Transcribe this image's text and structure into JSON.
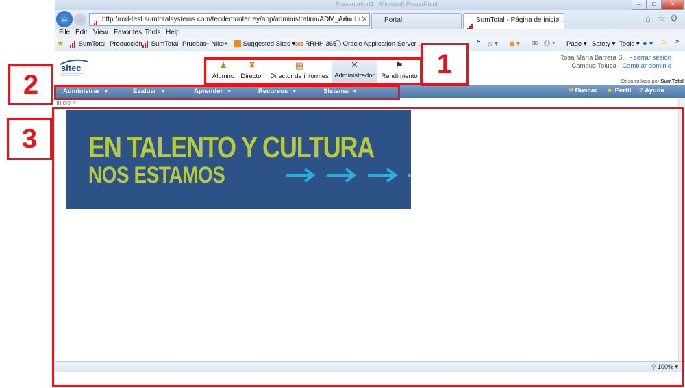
{
  "browser": {
    "address_url": "http://rod-test.sumtotalsystems.com/tecdemonterrey/app/administration/ADM_Adn",
    "address_controls": "⌕ ▾ ⊠ ↻ ✕",
    "window_title_ghost_1": "Presentation1",
    "window_title_ghost_2": "Microsoft PowerPoint",
    "tabs": [
      {
        "label": "Portal",
        "active": false
      },
      {
        "label": "SumTotal - Página de inicio...",
        "active": true,
        "close": "✕"
      }
    ],
    "menu": [
      "File",
      "Edit",
      "View",
      "Favorites",
      "Tools",
      "Help"
    ],
    "favorites": [
      "SumTotal -Producción",
      "SumTotal -Pruebas",
      "Nike+",
      "Suggested Sites ▾",
      "RRHH 365",
      "Oracle Application Server ..."
    ],
    "favorites_prefix": [
      "365"
    ],
    "command_bar": [
      "Page ▾",
      "Safety ▾",
      "Tools ▾"
    ],
    "zoom": "100%",
    "chevrons": "»"
  },
  "app": {
    "roles": [
      {
        "label": "Alumno",
        "icon": "student-icon"
      },
      {
        "label": "Director",
        "icon": "director-icon"
      },
      {
        "label": "Director de informes",
        "icon": "report-chart-icon"
      },
      {
        "label": "Administrador",
        "icon": "tools-icon",
        "selected": true
      },
      {
        "label": "Rendimiento",
        "icon": "runner-icon"
      }
    ],
    "user_name": "Rosa María Barrera S...",
    "logout": "cerrar sesión",
    "campus": "Campus Toluca",
    "change_domain": "Cambiar dominio",
    "developed_by": "Desarrollado por",
    "developer": "SumTotal",
    "nav": [
      "Administrar",
      "Evaluar",
      "Aprender",
      "Recursos",
      "Sistema"
    ],
    "search": "Buscar",
    "profile": "Perfil",
    "help": "Ayuda",
    "breadcrumb": "Inicio >",
    "logo_text": "sitec",
    "banner_line1": "EN TALENTO Y CULTURA",
    "banner_line2": "NOS ESTAMOS"
  },
  "annotations": [
    "1",
    "2",
    "3"
  ],
  "colors": {
    "annotation": "#e8141b",
    "nav_bar": "#5a82b1",
    "banner_bg": "#2c5288",
    "banner_text": "#b7c940",
    "banner_arrows": "#2ab0d6"
  }
}
